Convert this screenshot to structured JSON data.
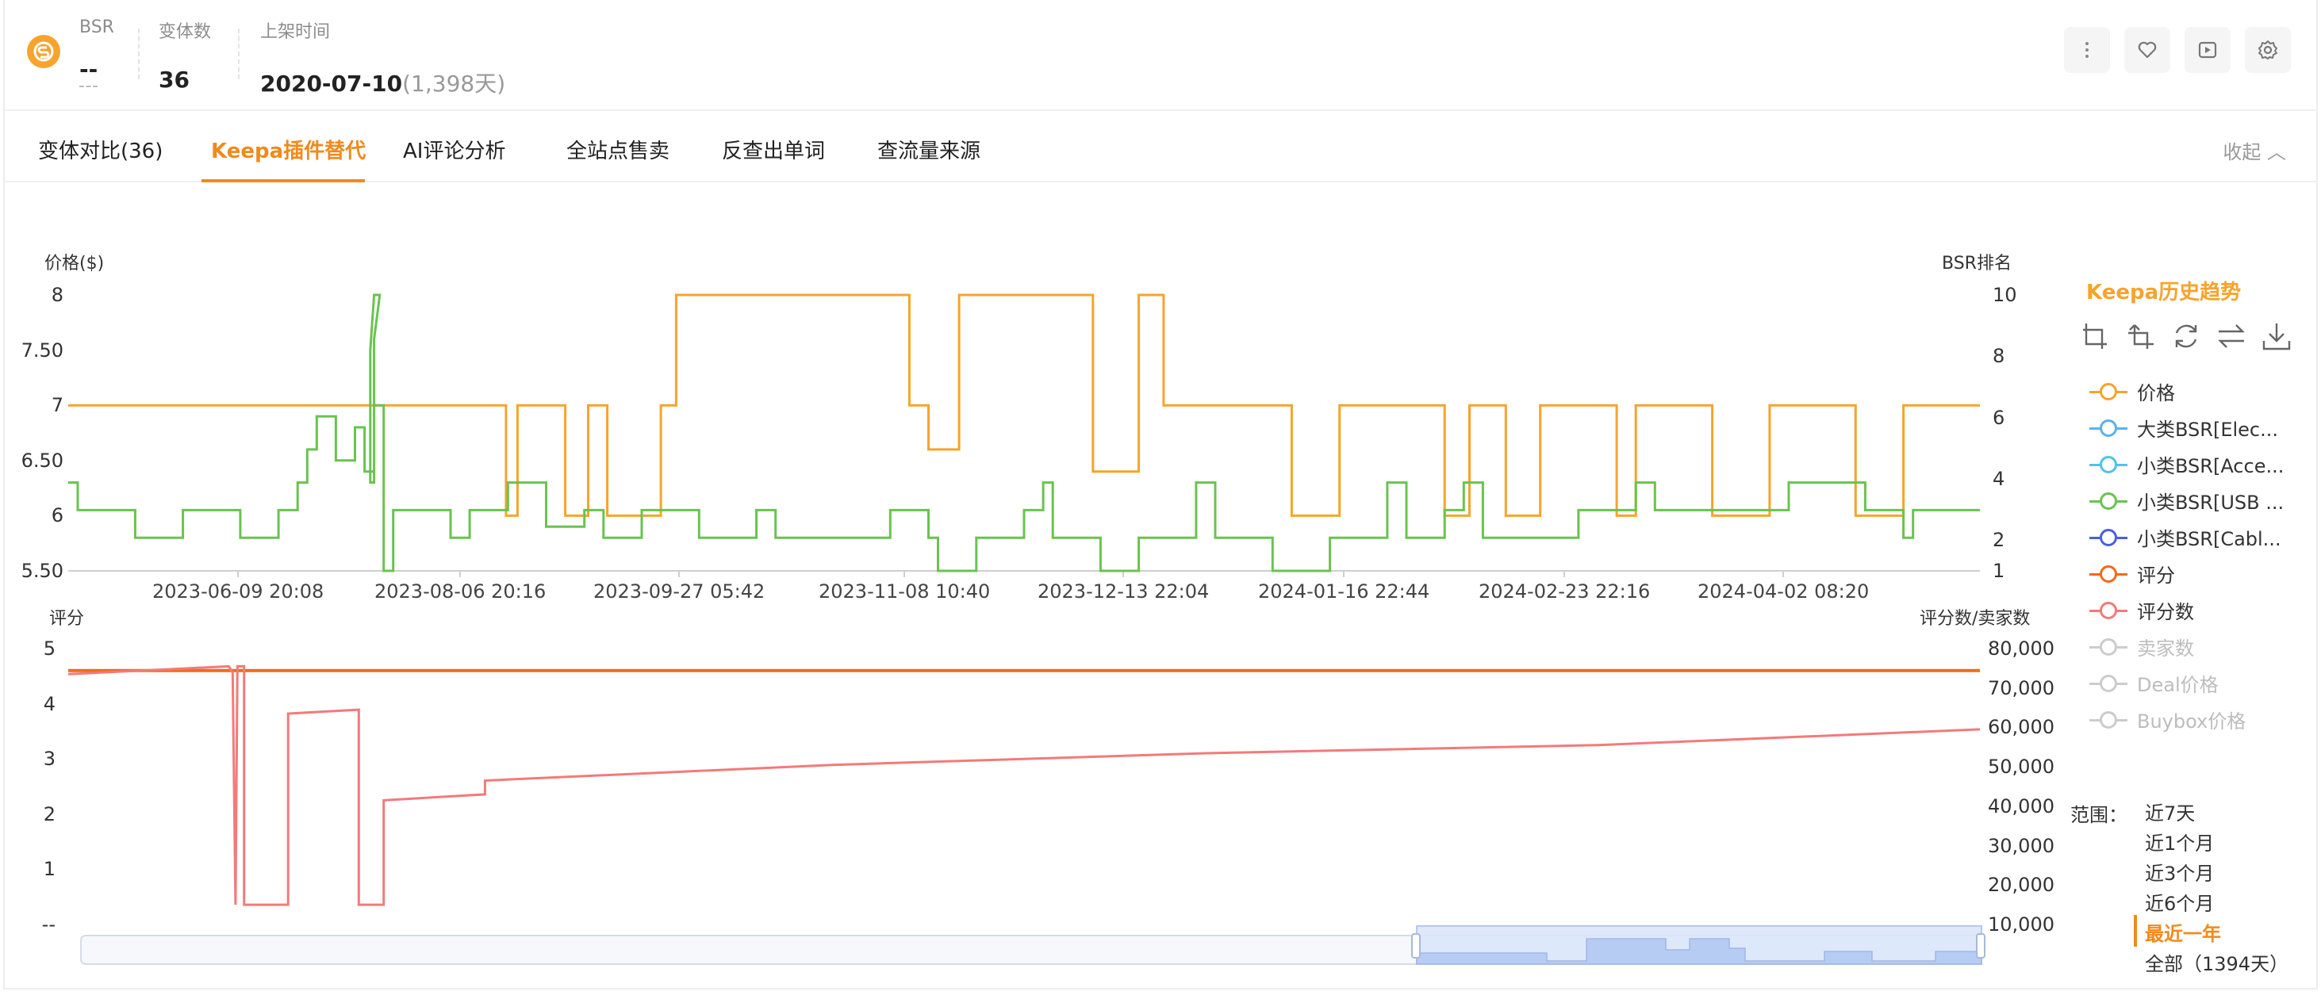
{
  "header": {
    "bsr_label": "BSR",
    "bsr_value": "--",
    "variants_label": "变体数",
    "variants_value": "36",
    "listed_label": "上架时间",
    "listed_date": "2020-07-10",
    "listed_days": "(1,398天)"
  },
  "tabs": [
    {
      "label": "变体对比(36)"
    },
    {
      "label": "Keepa插件替代",
      "active": true
    },
    {
      "label": "AI评论分析"
    },
    {
      "label": "全站点售卖"
    },
    {
      "label": "反查出单词"
    },
    {
      "label": "查流量来源"
    }
  ],
  "collapse_label": "收起",
  "legend": {
    "title": "Keepa历史趋势",
    "items": [
      {
        "label": "价格",
        "color": "#f7a32c",
        "on": true
      },
      {
        "label": "大类BSR[Elec...",
        "color": "#5ab1ef",
        "on": true
      },
      {
        "label": "小类BSR[Acce...",
        "color": "#4fc3e8",
        "on": true
      },
      {
        "label": "小类BSR[USB ...",
        "color": "#6ac34f",
        "on": true
      },
      {
        "label": "小类BSR[Cabl...",
        "color": "#4a5fe0",
        "on": true
      },
      {
        "label": "评分",
        "color": "#f06a1c",
        "on": true
      },
      {
        "label": "评分数",
        "color": "#f37a7a",
        "on": true
      },
      {
        "label": "卖家数",
        "color": "#cccccc",
        "on": false
      },
      {
        "label": "Deal价格",
        "color": "#cccccc",
        "on": false
      },
      {
        "label": "Buybox价格",
        "color": "#cccccc",
        "on": false
      }
    ]
  },
  "range": {
    "label": "范围：",
    "options": [
      "近7天",
      "近1个月",
      "近3个月",
      "近6个月",
      "最近一年",
      "全部（1394天）"
    ],
    "active_index": 4
  },
  "chart_data": [
    {
      "type": "line",
      "title": "",
      "ylabel": "价格($)",
      "y2label": "BSR排名",
      "ylim": [
        5.5,
        8
      ],
      "y2lim": [
        1,
        10
      ],
      "yticks": [
        "8",
        "7.50",
        "7",
        "6.50",
        "6",
        "5.50"
      ],
      "y2ticks": [
        "10",
        "8",
        "6",
        "4",
        "2",
        "1"
      ],
      "x_ticks": [
        "2023-06-09 20:08",
        "2023-08-06 20:16",
        "2023-09-27 05:42",
        "2023-11-08 10:40",
        "2023-12-13 22:04",
        "2024-01-16 22:44",
        "2024-02-23 22:16",
        "2024-04-02 08:20"
      ],
      "series": [
        {
          "name": "价格",
          "axis": "left",
          "color": "#f7a32c",
          "points": [
            [
              0,
              7
            ],
            [
              0.229,
              7
            ],
            [
              0.229,
              6
            ],
            [
              0.235,
              6
            ],
            [
              0.235,
              7
            ],
            [
              0.26,
              7
            ],
            [
              0.26,
              6
            ],
            [
              0.272,
              6
            ],
            [
              0.272,
              7
            ],
            [
              0.282,
              7
            ],
            [
              0.282,
              6
            ],
            [
              0.31,
              6
            ],
            [
              0.31,
              7
            ],
            [
              0.318,
              7
            ],
            [
              0.318,
              8
            ],
            [
              0.44,
              8
            ],
            [
              0.44,
              7
            ],
            [
              0.45,
              7
            ],
            [
              0.45,
              6.6
            ],
            [
              0.466,
              6.6
            ],
            [
              0.466,
              8
            ],
            [
              0.536,
              8
            ],
            [
              0.536,
              6.4
            ],
            [
              0.56,
              6.4
            ],
            [
              0.56,
              8
            ],
            [
              0.573,
              8
            ],
            [
              0.573,
              7
            ],
            [
              0.64,
              7
            ],
            [
              0.64,
              6
            ],
            [
              0.665,
              6
            ],
            [
              0.665,
              7
            ],
            [
              0.72,
              7
            ],
            [
              0.72,
              6
            ],
            [
              0.733,
              6
            ],
            [
              0.733,
              7
            ],
            [
              0.752,
              7
            ],
            [
              0.752,
              6
            ],
            [
              0.77,
              6
            ],
            [
              0.77,
              7
            ],
            [
              0.81,
              7
            ],
            [
              0.81,
              6
            ],
            [
              0.82,
              6
            ],
            [
              0.82,
              7
            ],
            [
              0.86,
              7
            ],
            [
              0.86,
              6
            ],
            [
              0.89,
              6
            ],
            [
              0.89,
              7
            ],
            [
              0.935,
              7
            ],
            [
              0.935,
              6
            ],
            [
              0.96,
              6
            ],
            [
              0.96,
              7
            ],
            [
              1,
              7
            ]
          ]
        },
        {
          "name": "小类BSR[USB ...",
          "axis": "left",
          "color": "#6ac34f",
          "points": [
            [
              0,
              6.3
            ],
            [
              0.005,
              6.3
            ],
            [
              0.005,
              6.05
            ],
            [
              0.035,
              6.05
            ],
            [
              0.035,
              5.8
            ],
            [
              0.06,
              5.8
            ],
            [
              0.06,
              6.05
            ],
            [
              0.09,
              6.05
            ],
            [
              0.09,
              5.8
            ],
            [
              0.11,
              5.8
            ],
            [
              0.11,
              6.05
            ],
            [
              0.12,
              6.05
            ],
            [
              0.12,
              6.3
            ],
            [
              0.125,
              6.3
            ],
            [
              0.125,
              6.6
            ],
            [
              0.13,
              6.6
            ],
            [
              0.13,
              6.9
            ],
            [
              0.14,
              6.9
            ],
            [
              0.14,
              6.5
            ],
            [
              0.15,
              6.5
            ],
            [
              0.15,
              6.8
            ],
            [
              0.155,
              6.8
            ],
            [
              0.155,
              6.4
            ],
            [
              0.16,
              6.4
            ],
            [
              0.16,
              7.6
            ],
            [
              0.163,
              8
            ],
            [
              0.16,
              8
            ],
            [
              0.158,
              7.5
            ],
            [
              0.158,
              6.3
            ],
            [
              0.16,
              6.3
            ],
            [
              0.16,
              7
            ],
            [
              0.165,
              7
            ],
            [
              0.165,
              5.5
            ],
            [
              0.17,
              5.5
            ],
            [
              0.17,
              6.05
            ],
            [
              0.2,
              6.05
            ],
            [
              0.2,
              5.8
            ],
            [
              0.21,
              5.8
            ],
            [
              0.21,
              6.05
            ],
            [
              0.23,
              6.05
            ],
            [
              0.23,
              6.3
            ],
            [
              0.25,
              6.3
            ],
            [
              0.25,
              5.9
            ],
            [
              0.27,
              5.9
            ],
            [
              0.27,
              6.05
            ],
            [
              0.28,
              6.05
            ],
            [
              0.28,
              5.8
            ],
            [
              0.3,
              5.8
            ],
            [
              0.3,
              6.05
            ],
            [
              0.33,
              6.05
            ],
            [
              0.33,
              5.8
            ],
            [
              0.36,
              5.8
            ],
            [
              0.36,
              6.05
            ],
            [
              0.37,
              6.05
            ],
            [
              0.37,
              5.8
            ],
            [
              0.43,
              5.8
            ],
            [
              0.43,
              6.05
            ],
            [
              0.45,
              6.05
            ],
            [
              0.45,
              5.8
            ],
            [
              0.455,
              5.8
            ],
            [
              0.455,
              5.5
            ],
            [
              0.475,
              5.5
            ],
            [
              0.475,
              5.8
            ],
            [
              0.5,
              5.8
            ],
            [
              0.5,
              6.05
            ],
            [
              0.51,
              6.05
            ],
            [
              0.51,
              6.3
            ],
            [
              0.515,
              6.3
            ],
            [
              0.515,
              5.8
            ],
            [
              0.54,
              5.8
            ],
            [
              0.54,
              5.5
            ],
            [
              0.56,
              5.5
            ],
            [
              0.56,
              5.8
            ],
            [
              0.59,
              5.8
            ],
            [
              0.59,
              6.3
            ],
            [
              0.6,
              6.3
            ],
            [
              0.6,
              5.8
            ],
            [
              0.63,
              5.8
            ],
            [
              0.63,
              5.5
            ],
            [
              0.66,
              5.5
            ],
            [
              0.66,
              5.8
            ],
            [
              0.69,
              5.8
            ],
            [
              0.69,
              6.3
            ],
            [
              0.7,
              6.3
            ],
            [
              0.7,
              5.8
            ],
            [
              0.72,
              5.8
            ],
            [
              0.72,
              6.05
            ],
            [
              0.73,
              6.05
            ],
            [
              0.73,
              6.3
            ],
            [
              0.74,
              6.3
            ],
            [
              0.74,
              5.8
            ],
            [
              0.79,
              5.8
            ],
            [
              0.79,
              6.05
            ],
            [
              0.82,
              6.05
            ],
            [
              0.82,
              6.3
            ],
            [
              0.83,
              6.3
            ],
            [
              0.83,
              6.05
            ],
            [
              0.9,
              6.05
            ],
            [
              0.9,
              6.3
            ],
            [
              0.94,
              6.3
            ],
            [
              0.94,
              6.05
            ],
            [
              0.96,
              6.05
            ],
            [
              0.96,
              5.8
            ],
            [
              0.965,
              5.8
            ],
            [
              0.965,
              6.05
            ],
            [
              1,
              6.05
            ]
          ]
        }
      ]
    },
    {
      "type": "line",
      "title": "",
      "ylabel": "评分",
      "y2label": "评分数/卖家数",
      "ylim": [
        0,
        5
      ],
      "y2lim": [
        10000,
        80000
      ],
      "yticks": [
        "5",
        "4",
        "3",
        "2",
        "1",
        "--"
      ],
      "y2ticks": [
        "80,000",
        "70,000",
        "60,000",
        "50,000",
        "40,000",
        "30,000",
        "20,000",
        "10,000"
      ],
      "series": [
        {
          "name": "评分",
          "axis": "left",
          "color": "#f06a1c",
          "points": [
            [
              0,
              4.6
            ],
            [
              1,
              4.6
            ]
          ]
        },
        {
          "name": "评分数",
          "axis": "right",
          "color": "#f37a7a",
          "points": [
            [
              0,
              73500
            ],
            [
              0.084,
              75500
            ],
            [
              0.086,
              74000
            ],
            [
              0.0875,
              15000
            ],
            [
              0.0885,
              75500
            ],
            [
              0.092,
              75500
            ],
            [
              0.092,
              15000
            ],
            [
              0.115,
              15000
            ],
            [
              0.115,
              63500
            ],
            [
              0.152,
              64500
            ],
            [
              0.152,
              15000
            ],
            [
              0.165,
              15000
            ],
            [
              0.165,
              41500
            ],
            [
              0.2,
              42500
            ],
            [
              0.218,
              43000
            ],
            [
              0.218,
              46500
            ],
            [
              0.4,
              50500
            ],
            [
              0.6,
              53500
            ],
            [
              0.8,
              55500
            ],
            [
              1,
              59500
            ]
          ]
        }
      ]
    }
  ]
}
